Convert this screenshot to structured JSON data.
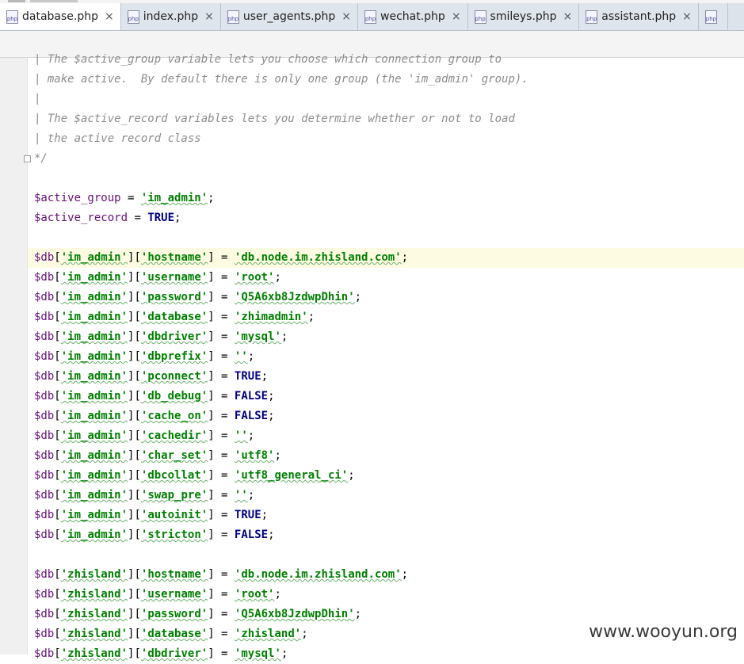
{
  "tabs": [
    {
      "label": "database.php",
      "icon": "php-file-icon",
      "active": true
    },
    {
      "label": "index.php",
      "icon": "php-file-icon",
      "active": false
    },
    {
      "label": "user_agents.php",
      "icon": "php-file-icon",
      "active": false
    },
    {
      "label": "wechat.php",
      "icon": "php-file-icon",
      "active": false
    },
    {
      "label": "smileys.php",
      "icon": "php-file-icon",
      "active": false
    },
    {
      "label": "assistant.php",
      "icon": "php-file-icon",
      "active": false
    },
    {
      "label": "",
      "icon": "php-file-icon",
      "active": false
    }
  ],
  "icon_text": "php",
  "close_glyph": "×",
  "editor": {
    "current_line": 11,
    "lines": [
      [
        [
          "| The $active_group variable lets you choose which connection group to",
          "cm"
        ]
      ],
      [
        [
          "| make active.  By default there is only one group (the 'im_admin' group).",
          "cm"
        ]
      ],
      [
        [
          "|",
          "cm"
        ]
      ],
      [
        [
          "| The $active_record variables lets you determine whether or not to load",
          "cm"
        ]
      ],
      [
        [
          "| the active record class",
          "cm"
        ]
      ],
      [
        [
          "*/",
          "cm"
        ]
      ],
      [],
      [
        [
          "$active_group",
          "var"
        ],
        [
          " = ",
          "op"
        ],
        [
          "'im_admin'",
          "str"
        ],
        [
          ";",
          "op"
        ]
      ],
      [
        [
          "$active_record",
          "var"
        ],
        [
          " = ",
          "op"
        ],
        [
          "TRUE",
          "kw"
        ],
        [
          ";",
          "op"
        ]
      ],
      [],
      [
        [
          "$db",
          "var"
        ],
        [
          "[",
          "op"
        ],
        [
          "'im_admin'",
          "str"
        ],
        [
          "][",
          "op"
        ],
        [
          "'hostname'",
          "str"
        ],
        [
          "] = ",
          "op"
        ],
        [
          "'db.node.im.zhisland.com'",
          "str"
        ],
        [
          ";",
          "op"
        ]
      ],
      [
        [
          "$db",
          "var"
        ],
        [
          "[",
          "op"
        ],
        [
          "'im_admin'",
          "str"
        ],
        [
          "][",
          "op"
        ],
        [
          "'username'",
          "str"
        ],
        [
          "] = ",
          "op"
        ],
        [
          "'root'",
          "str"
        ],
        [
          ";",
          "op"
        ]
      ],
      [
        [
          "$db",
          "var"
        ],
        [
          "[",
          "op"
        ],
        [
          "'im_admin'",
          "str"
        ],
        [
          "][",
          "op"
        ],
        [
          "'password'",
          "str"
        ],
        [
          "] = ",
          "op"
        ],
        [
          "'Q5A6xb8JzdwpDhin'",
          "str"
        ],
        [
          ";",
          "op"
        ]
      ],
      [
        [
          "$db",
          "var"
        ],
        [
          "[",
          "op"
        ],
        [
          "'im_admin'",
          "str"
        ],
        [
          "][",
          "op"
        ],
        [
          "'database'",
          "str"
        ],
        [
          "] = ",
          "op"
        ],
        [
          "'zhimadmin'",
          "str"
        ],
        [
          ";",
          "op"
        ]
      ],
      [
        [
          "$db",
          "var"
        ],
        [
          "[",
          "op"
        ],
        [
          "'im_admin'",
          "str"
        ],
        [
          "][",
          "op"
        ],
        [
          "'dbdriver'",
          "str"
        ],
        [
          "] = ",
          "op"
        ],
        [
          "'mysql'",
          "str"
        ],
        [
          ";",
          "op"
        ]
      ],
      [
        [
          "$db",
          "var"
        ],
        [
          "[",
          "op"
        ],
        [
          "'im_admin'",
          "str"
        ],
        [
          "][",
          "op"
        ],
        [
          "'dbprefix'",
          "str"
        ],
        [
          "] = ",
          "op"
        ],
        [
          "''",
          "str"
        ],
        [
          ";",
          "op"
        ]
      ],
      [
        [
          "$db",
          "var"
        ],
        [
          "[",
          "op"
        ],
        [
          "'im_admin'",
          "str"
        ],
        [
          "][",
          "op"
        ],
        [
          "'pconnect'",
          "str"
        ],
        [
          "] = ",
          "op"
        ],
        [
          "TRUE",
          "kw"
        ],
        [
          ";",
          "op"
        ]
      ],
      [
        [
          "$db",
          "var"
        ],
        [
          "[",
          "op"
        ],
        [
          "'im_admin'",
          "str"
        ],
        [
          "][",
          "op"
        ],
        [
          "'db_debug'",
          "str"
        ],
        [
          "] = ",
          "op"
        ],
        [
          "FALSE",
          "kw"
        ],
        [
          ";",
          "op"
        ]
      ],
      [
        [
          "$db",
          "var"
        ],
        [
          "[",
          "op"
        ],
        [
          "'im_admin'",
          "str"
        ],
        [
          "][",
          "op"
        ],
        [
          "'cache_on'",
          "str"
        ],
        [
          "] = ",
          "op"
        ],
        [
          "FALSE",
          "kw"
        ],
        [
          ";",
          "op"
        ]
      ],
      [
        [
          "$db",
          "var"
        ],
        [
          "[",
          "op"
        ],
        [
          "'im_admin'",
          "str"
        ],
        [
          "][",
          "op"
        ],
        [
          "'cachedir'",
          "str"
        ],
        [
          "] = ",
          "op"
        ],
        [
          "''",
          "str"
        ],
        [
          ";",
          "op"
        ]
      ],
      [
        [
          "$db",
          "var"
        ],
        [
          "[",
          "op"
        ],
        [
          "'im_admin'",
          "str"
        ],
        [
          "][",
          "op"
        ],
        [
          "'char_set'",
          "str"
        ],
        [
          "] = ",
          "op"
        ],
        [
          "'utf8'",
          "str"
        ],
        [
          ";",
          "op"
        ]
      ],
      [
        [
          "$db",
          "var"
        ],
        [
          "[",
          "op"
        ],
        [
          "'im_admin'",
          "str"
        ],
        [
          "][",
          "op"
        ],
        [
          "'dbcollat'",
          "str"
        ],
        [
          "] = ",
          "op"
        ],
        [
          "'utf8_general_ci'",
          "str"
        ],
        [
          ";",
          "op"
        ]
      ],
      [
        [
          "$db",
          "var"
        ],
        [
          "[",
          "op"
        ],
        [
          "'im_admin'",
          "str"
        ],
        [
          "][",
          "op"
        ],
        [
          "'swap_pre'",
          "str"
        ],
        [
          "] = ",
          "op"
        ],
        [
          "''",
          "str"
        ],
        [
          ";",
          "op"
        ]
      ],
      [
        [
          "$db",
          "var"
        ],
        [
          "[",
          "op"
        ],
        [
          "'im_admin'",
          "str"
        ],
        [
          "][",
          "op"
        ],
        [
          "'autoinit'",
          "str"
        ],
        [
          "] = ",
          "op"
        ],
        [
          "TRUE",
          "kw"
        ],
        [
          ";",
          "op"
        ]
      ],
      [
        [
          "$db",
          "var"
        ],
        [
          "[",
          "op"
        ],
        [
          "'im_admin'",
          "str"
        ],
        [
          "][",
          "op"
        ],
        [
          "'stricton'",
          "str"
        ],
        [
          "] = ",
          "op"
        ],
        [
          "FALSE",
          "kw"
        ],
        [
          ";",
          "op"
        ]
      ],
      [],
      [
        [
          "$db",
          "var"
        ],
        [
          "[",
          "op"
        ],
        [
          "'zhisland'",
          "str"
        ],
        [
          "][",
          "op"
        ],
        [
          "'hostname'",
          "str"
        ],
        [
          "] = ",
          "op"
        ],
        [
          "'db.node.im.zhisland.com'",
          "str"
        ],
        [
          ";",
          "op"
        ]
      ],
      [
        [
          "$db",
          "var"
        ],
        [
          "[",
          "op"
        ],
        [
          "'zhisland'",
          "str"
        ],
        [
          "][",
          "op"
        ],
        [
          "'username'",
          "str"
        ],
        [
          "] = ",
          "op"
        ],
        [
          "'root'",
          "str"
        ],
        [
          ";",
          "op"
        ]
      ],
      [
        [
          "$db",
          "var"
        ],
        [
          "[",
          "op"
        ],
        [
          "'zhisland'",
          "str"
        ],
        [
          "][",
          "op"
        ],
        [
          "'password'",
          "str"
        ],
        [
          "] = ",
          "op"
        ],
        [
          "'Q5A6xb8JzdwpDhin'",
          "str"
        ],
        [
          ";",
          "op"
        ]
      ],
      [
        [
          "$db",
          "var"
        ],
        [
          "[",
          "op"
        ],
        [
          "'zhisland'",
          "str"
        ],
        [
          "][",
          "op"
        ],
        [
          "'database'",
          "str"
        ],
        [
          "] = ",
          "op"
        ],
        [
          "'zhisland'",
          "str"
        ],
        [
          ";",
          "op"
        ]
      ],
      [
        [
          "$db",
          "var"
        ],
        [
          "[",
          "op"
        ],
        [
          "'zhisland'",
          "str"
        ],
        [
          "][",
          "op"
        ],
        [
          "'dbdriver'",
          "str"
        ],
        [
          "] = ",
          "op"
        ],
        [
          "'mysql'",
          "str"
        ],
        [
          ";",
          "op"
        ]
      ]
    ]
  },
  "watermark": "www.wooyun.org",
  "colors": {
    "comment": "#8c8c8c",
    "variable": "#660e7a",
    "string": "#008000",
    "keyword": "#000080",
    "current_line_bg": "#fdfce3"
  }
}
